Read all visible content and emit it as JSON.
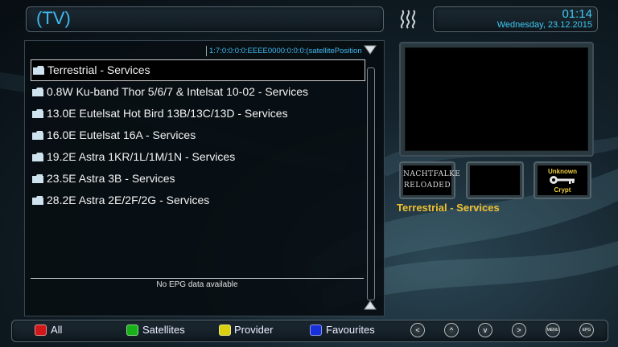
{
  "header": {
    "title": "(TV)",
    "time": "01:14",
    "date": "Wednesday, 23.12.2015"
  },
  "channel_list": {
    "service_path": "1:7:0:0:0:0:EEEE0000:0:0:0:(satellitePosition",
    "selected_index": 0,
    "items": [
      {
        "label": "Terrestrial - Services"
      },
      {
        "label": "0.8W Ku-band Thor 5/6/7 & Intelsat 10-02 - Services"
      },
      {
        "label": "13.0E Eutelsat Hot Bird 13B/13C/13D - Services"
      },
      {
        "label": "16.0E Eutelsat 16A - Services"
      },
      {
        "label": "19.2E Astra 1KR/1L/1M/1N - Services"
      },
      {
        "label": "23.5E Astra 3B - Services"
      },
      {
        "label": "28.2E Astra 2E/2F/2G - Services"
      }
    ],
    "epg_text": "No EPG data available"
  },
  "info": {
    "brand_logo_text": [
      "NACHTFALKE",
      "RELOADED"
    ],
    "crypt_top": "Unknown",
    "crypt_bottom": "Crypt",
    "service_name": "Terrestrial - Services"
  },
  "footer": {
    "color_keys": [
      {
        "label": "All",
        "color": "#d01818"
      },
      {
        "label": "Satellites",
        "color": "#18b018"
      },
      {
        "label": "Provider",
        "color": "#d8d010"
      },
      {
        "label": "Favourites",
        "color": "#1830d8"
      }
    ],
    "nav_buttons": [
      "<",
      "^",
      "v",
      ">",
      "MENU",
      "EPG"
    ]
  },
  "colors": {
    "accent_blue": "#40b8f0",
    "service_yellow": "#f0c030"
  }
}
